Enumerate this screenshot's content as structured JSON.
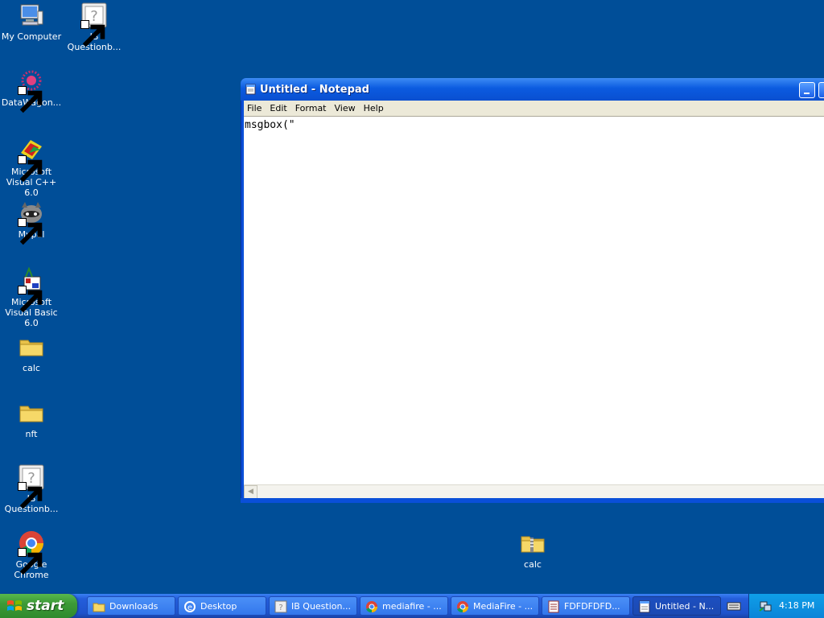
{
  "desktop": {
    "icons": [
      {
        "label": "My Computer",
        "icon": "my-computer-icon"
      },
      {
        "label": "IB Questionb...",
        "icon": "unknown-file-icon"
      },
      {
        "label": "DataWagon...",
        "icon": "datawagon-icon"
      },
      {
        "label": "Microsoft Visual C++ 6.0",
        "icon": "visual-cpp-icon"
      },
      {
        "label": "Mypal",
        "icon": "mypal-raccoon-icon"
      },
      {
        "label": "Microsoft Visual Basic 6.0",
        "icon": "visual-basic-icon"
      },
      {
        "label": "calc",
        "icon": "folder-icon"
      },
      {
        "label": "nft",
        "icon": "folder-icon"
      },
      {
        "label": "IB Questionb...",
        "icon": "unknown-file-icon"
      },
      {
        "label": "Google Chrome",
        "icon": "chrome-icon"
      },
      {
        "label": "calc",
        "icon": "zip-folder-icon"
      }
    ]
  },
  "notepad": {
    "title": "Untitled - Notepad",
    "menu": [
      "File",
      "Edit",
      "Format",
      "View",
      "Help"
    ],
    "content": "msgbox(\""
  },
  "taskbar": {
    "start_label": "start",
    "tasks": [
      {
        "label": "Downloads",
        "icon": "folder-icon"
      },
      {
        "label": "Desktop",
        "icon": "ie-icon"
      },
      {
        "label": "IB Question...",
        "icon": "unknown-file-icon"
      },
      {
        "label": "mediafire - ...",
        "icon": "chrome-icon"
      },
      {
        "label": "MediaFire - ...",
        "icon": "chrome-icon"
      },
      {
        "label": "FDFDFDFD...",
        "icon": "document-icon"
      },
      {
        "label": "Untitled - N...",
        "icon": "notepad-icon"
      }
    ],
    "clock": "4:18 PM"
  },
  "colors": {
    "desktop_bg": "#004e98",
    "titlebar": "#0b5be0",
    "start_green": "#3c9a37",
    "taskbar_blue": "#245edb"
  }
}
